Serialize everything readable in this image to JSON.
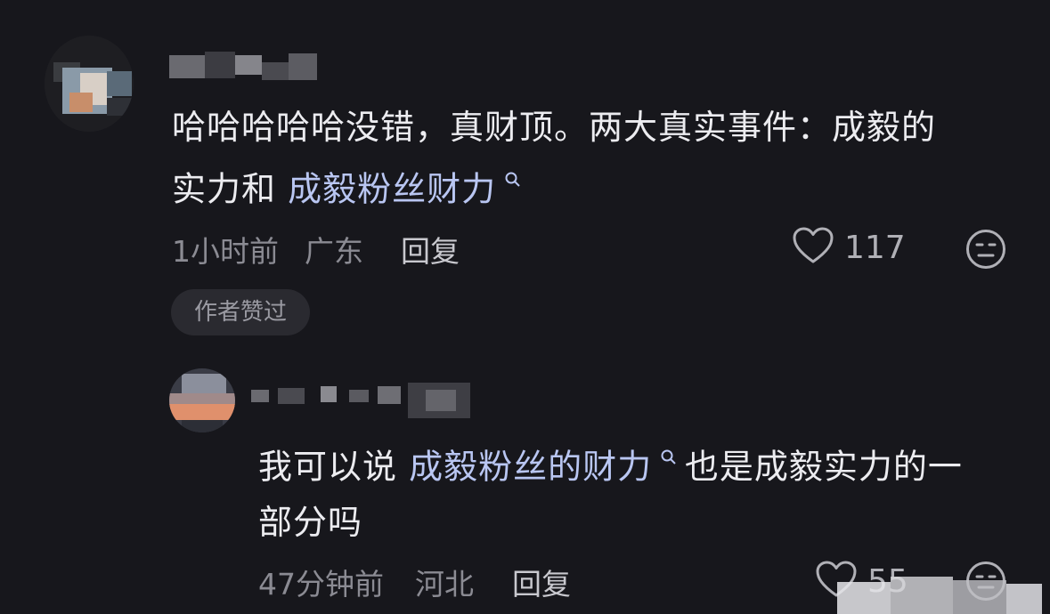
{
  "main_comment": {
    "text_line1": "哈哈哈哈哈没错，真财顶。两大真实事件：成毅的",
    "text_line2_prefix": "实力和 ",
    "search_link": "成毅粉丝财力",
    "time": "1小时前",
    "location": "广东",
    "reply_label": "回复",
    "like_count": "117",
    "author_badge": "作者赞过"
  },
  "reply_comment": {
    "text_prefix": "我可以说 ",
    "search_link": "成毅粉丝的财力",
    "text_suffix": " 也是成毅实力的一",
    "text_line2": "部分吗",
    "time": "47分钟前",
    "location": "河北",
    "reply_label": "回复",
    "like_count": "55"
  },
  "icons": {
    "like": "heart-outline-icon",
    "dislike": "meh-face-icon",
    "search": "search-icon"
  },
  "colors": {
    "background": "#17171c",
    "text": "#ececf0",
    "link": "#b9c6f2",
    "meta": "#8b8b93"
  }
}
